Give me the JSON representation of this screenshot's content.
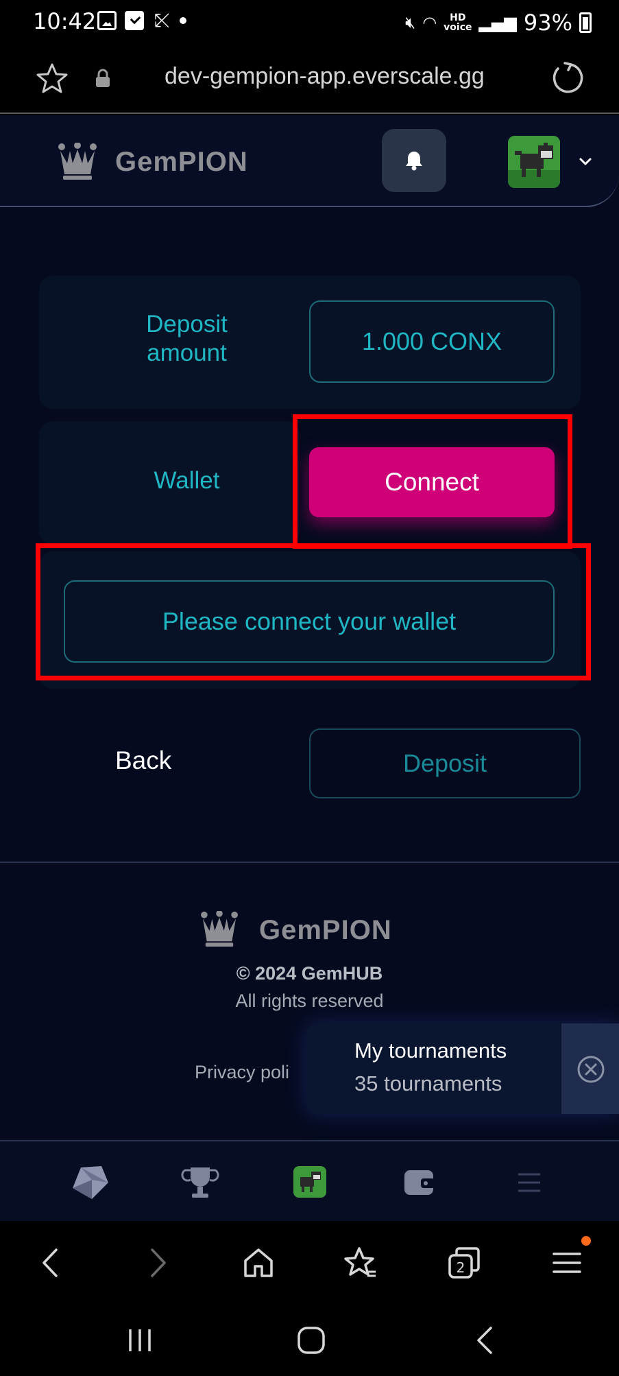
{
  "status_bar": {
    "time": "10:42",
    "hd_label": "HD\nvoice",
    "battery": "93%"
  },
  "browser": {
    "url": "dev-gempion-app.everscale.gg"
  },
  "header": {
    "brand": "GemPION"
  },
  "deposit": {
    "amount_label": "Deposit amount",
    "amount_value": "1.000 CONX",
    "wallet_label": "Wallet",
    "connect_label": "Connect",
    "wallet_message": "Please connect your wallet",
    "back_label": "Back",
    "deposit_label": "Deposit"
  },
  "footer": {
    "brand": "GemPION",
    "copyright": "© 2024 GemHUB",
    "rights": "All rights reserved",
    "privacy": "Privacy poli"
  },
  "toast": {
    "title": "My tournaments",
    "count": "35 tournaments"
  },
  "colors": {
    "accent": "#1fb7c4",
    "connect": "#cf0077",
    "annotation": "#ff0000",
    "background": "#050a1f"
  }
}
